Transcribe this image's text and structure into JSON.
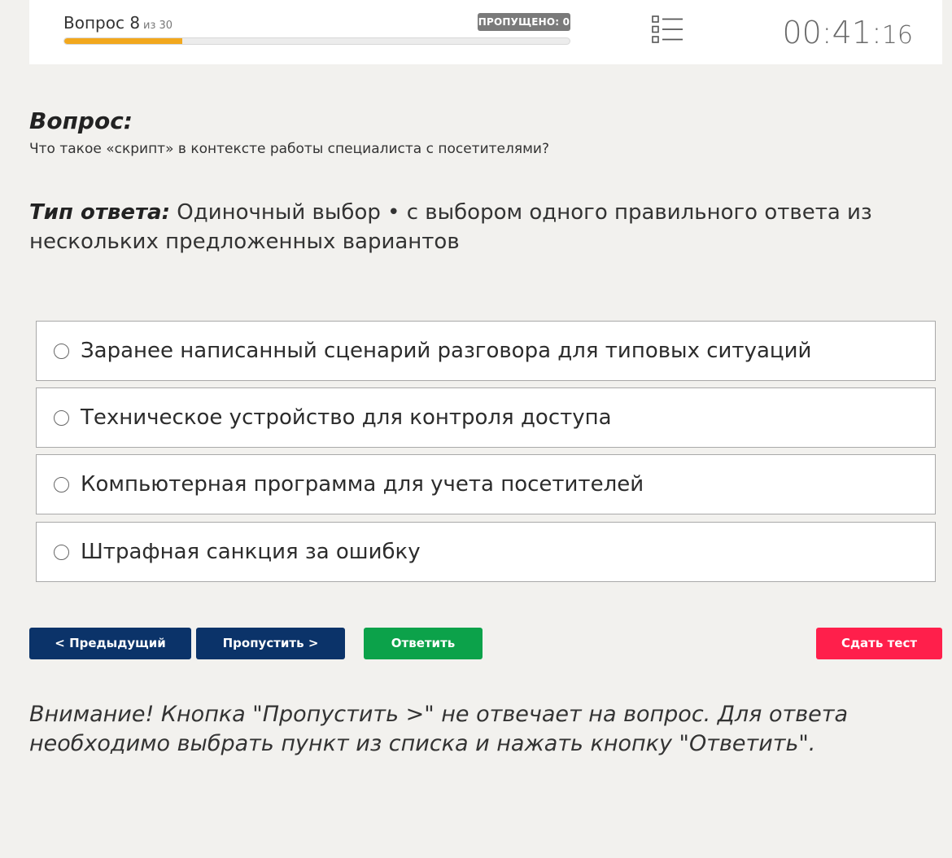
{
  "header": {
    "question_label": "Вопрос 8",
    "question_of": "из 30",
    "skipped_badge": "ПРОПУЩЕНО: 0",
    "progress_fraction": 0.233,
    "timer_main": "00:41:",
    "timer_seconds": "16",
    "progress_color": "#f2a81d"
  },
  "question": {
    "heading": "Вопрос:",
    "text": "Что такое «скрипт» в контексте работы специалиста с посетителями?",
    "answer_type_label": "Тип ответа:",
    "answer_type_text": " Одиночный выбор • с выбором одного правильного ответа из нескольких предложенных вариантов"
  },
  "options": [
    {
      "label": "Заранее написанный сценарий разговора для типовых ситуаций"
    },
    {
      "label": "Техническое устройство для контроля доступа"
    },
    {
      "label": "Компьютерная программа для учета посетителей"
    },
    {
      "label": "Штрафная санкция за ошибку"
    }
  ],
  "buttons": {
    "prev": "< Предыдущий",
    "skip": "Пропустить >",
    "answer": "Ответить",
    "submit": "Сдать тест"
  },
  "colors": {
    "nav_button": "#0b3369",
    "answer_button": "#0ca24a",
    "submit_button": "#ff1f4b"
  },
  "notice": "Внимание! Кнопка \"Пропустить >\" не отвечает на вопрос. Для ответа необходимо выбрать пункт из списка и нажать кнопку \"Ответить\".",
  "icons": {
    "question_list": "list-icon",
    "option_radio": "radio-icon"
  }
}
